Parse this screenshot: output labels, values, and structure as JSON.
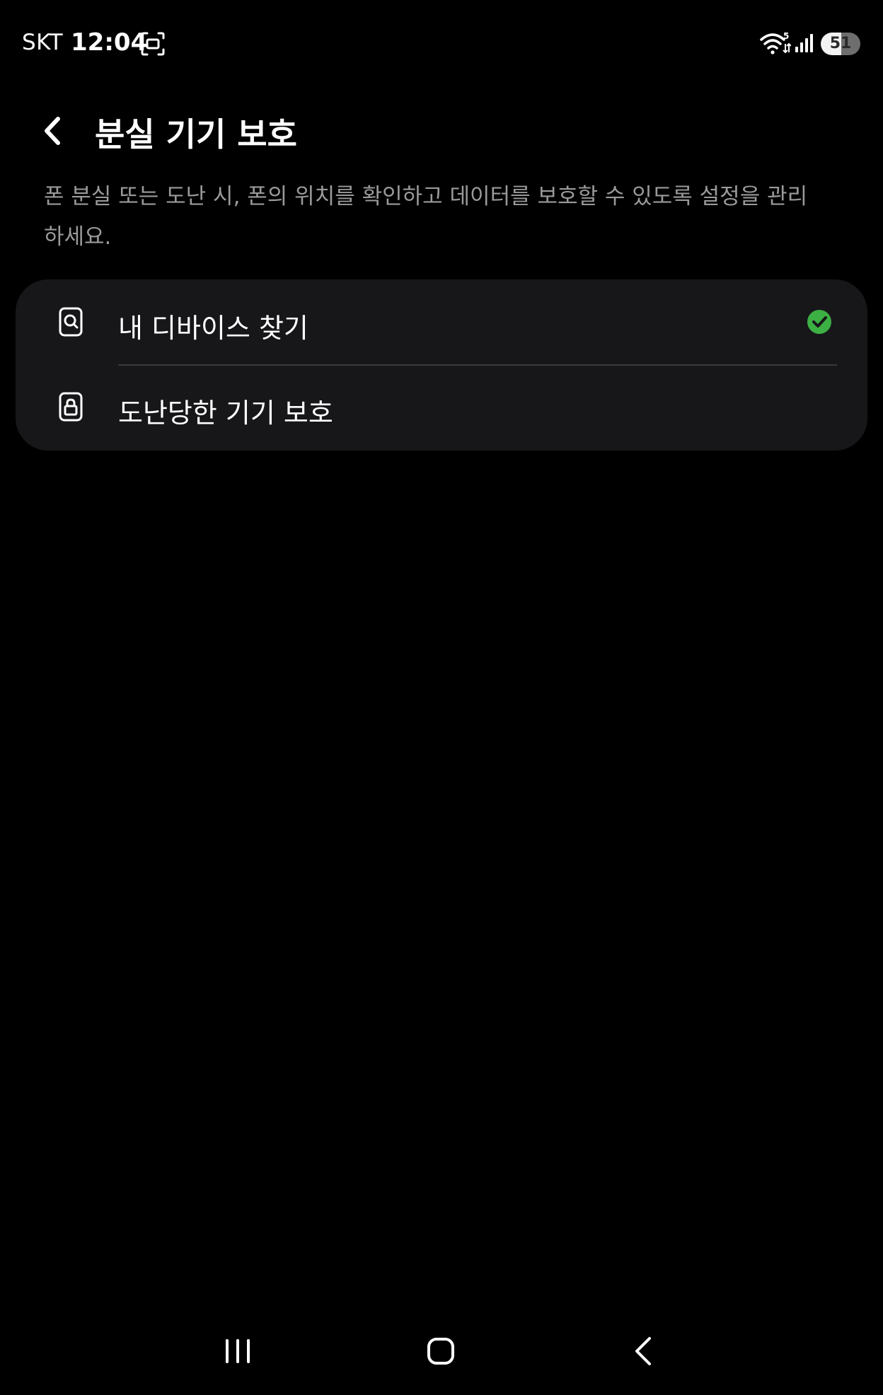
{
  "status_bar": {
    "carrier": "SKT",
    "time": "12:04",
    "battery_level": "51",
    "battery_fraction": 0.51
  },
  "header": {
    "title": "분실 기기 보호",
    "back_icon": "chevron-left-icon"
  },
  "description": "폰 분실 또는 도난 시, 폰의 위치를 확인하고 데이터를 보호할 수 있도록 설정을 관리하세요.",
  "items": [
    {
      "label": "내 디바이스 찾기",
      "icon": "find-device-icon",
      "status": "enabled",
      "status_icon": "check-circle-icon"
    },
    {
      "label": "도난당한 기기 보호",
      "icon": "lock-device-icon"
    }
  ],
  "colors": {
    "background": "#000000",
    "card": "#17171a",
    "check": "#3cb043",
    "description_text": "#9a9a9a"
  },
  "nav_bar": {
    "recents_icon": "recents-icon",
    "home_icon": "home-icon",
    "back_icon": "back-icon"
  }
}
